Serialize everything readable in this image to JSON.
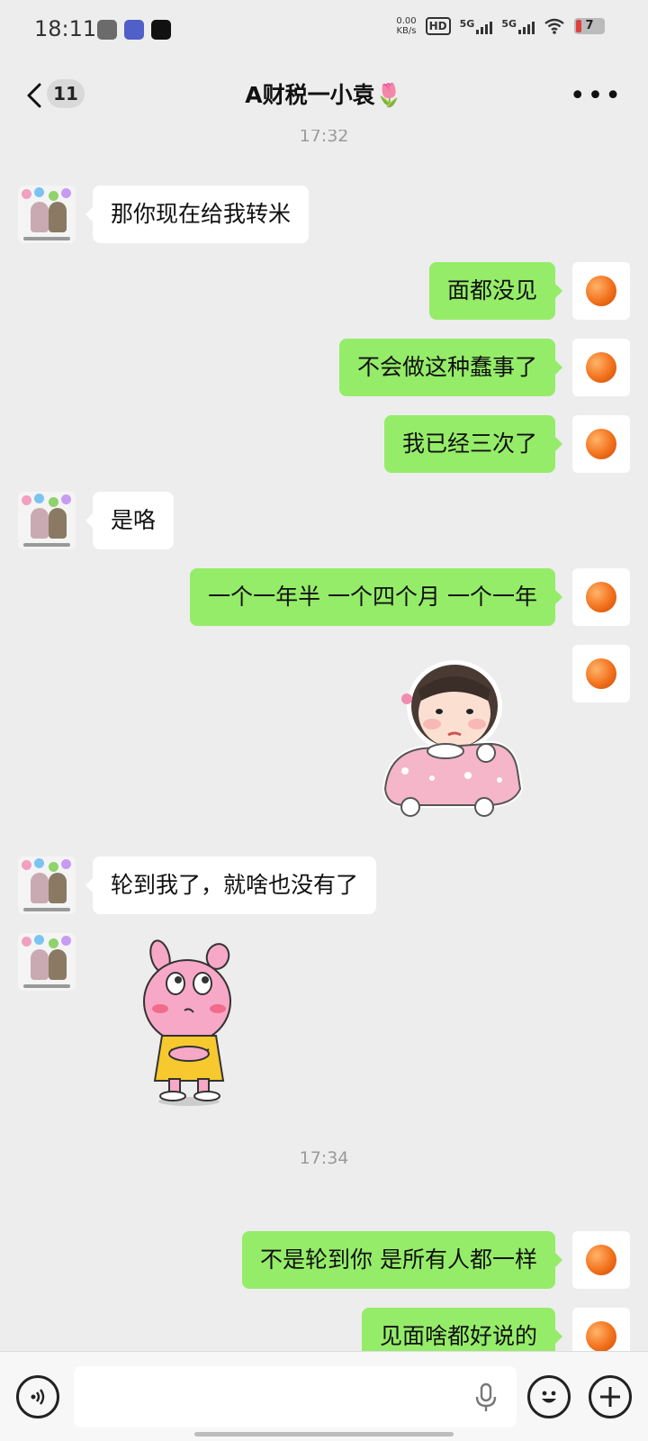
{
  "status_bar": {
    "time": "18:11",
    "net_speed_top": "0.00",
    "net_speed_bottom": "KB/s",
    "hd_label": "HD",
    "sim1_label": "5G",
    "sim2_label": "5G",
    "battery": "7"
  },
  "nav": {
    "unread_count": "11",
    "title": "A财税一小袁",
    "title_emoji": "🌷"
  },
  "chat": {
    "timestamp_1": "17:32",
    "timestamp_2": "17:34",
    "messages": [
      {
        "side": "left",
        "text": "那你现在给我转米"
      },
      {
        "side": "right",
        "text": "面都没见"
      },
      {
        "side": "right",
        "text": "不会做这种蠢事了"
      },
      {
        "side": "right",
        "text": "我已经三次了"
      },
      {
        "side": "left",
        "text": "是咯"
      },
      {
        "side": "right",
        "text": "一个一年半 一个四个月 一个一年"
      },
      {
        "side": "right",
        "type": "sticker",
        "sticker": "baby-in-pink-car-sticker"
      },
      {
        "side": "left",
        "text": "轮到我了，就啥也没有了"
      },
      {
        "side": "left",
        "type": "sticker",
        "sticker": "pink-bunny-sticker"
      },
      {
        "side": "right",
        "text": "不是轮到你 是所有人都一样"
      },
      {
        "side": "right",
        "text": "见面啥都好说的"
      }
    ]
  },
  "input_bar": {
    "voice_icon": "voice-icon",
    "mic_icon": "mic-icon",
    "emoji_icon": "emoji-icon",
    "plus_icon": "plus-icon"
  }
}
